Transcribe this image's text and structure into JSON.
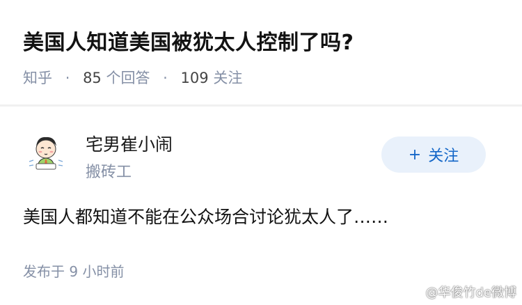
{
  "question": {
    "title": "美国人知道美国被犹太人控制了吗?",
    "source": "知乎",
    "answer_count": "85",
    "answer_label": "个回答",
    "follower_count": "109",
    "follower_label": "关注",
    "separator": "·"
  },
  "answer": {
    "author_name": "宅男崔小闹",
    "author_headline": "搬砖工",
    "follow_plus": "+",
    "follow_label": "关注",
    "content": "美国人都知道不能在公众场合讨论犹太人了……",
    "time": "发布于 9 小时前"
  },
  "watermark": "@华俊竹de微博",
  "colors": {
    "accent": "#1366c8",
    "follow_bg": "#e9f1fb",
    "meta_text": "#8590a6"
  },
  "icons": {
    "avatar": "cartoon-avatar-icon",
    "plus": "plus-icon"
  }
}
